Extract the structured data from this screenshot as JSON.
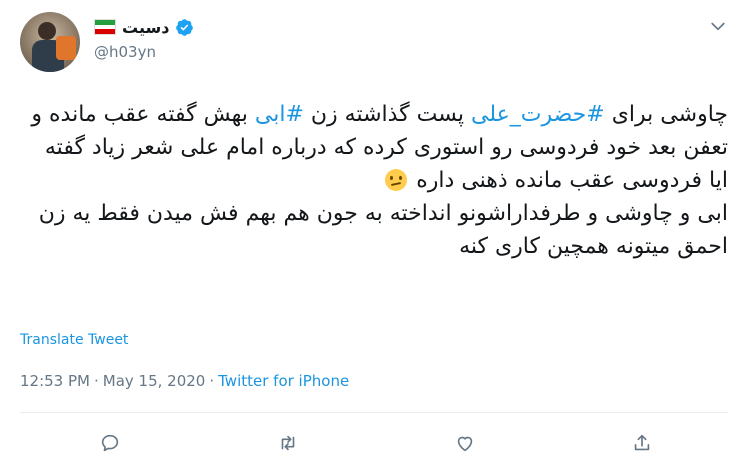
{
  "user": {
    "display_name": "دسیت",
    "handle": "@h03yn",
    "flag_colors": [
      "#239f40",
      "#ffffff",
      "#da0000"
    ],
    "verified_color": "#1da1f2"
  },
  "tweet": {
    "seg1": "چاوشی برای ",
    "hashtag1": "#حضرت_علی",
    "seg2": " پست گذاشته زن ",
    "hashtag2": "#ابی",
    "seg3": " بهش گفته عقب مانده و تعفن بعد خود فردوسی رو استوری کرده که درباره امام علی شعر زیاد گفته ایا فردوسی عقب مانده ذهنی داره",
    "emoji": "confused-face",
    "para2": "ابی و چاوشی و طرفداراشونو انداخته به جون هم بهم فش میدن فقط یه زن احمق میتونه همچین کاری کنه"
  },
  "translate_label": "Translate Tweet",
  "meta": {
    "time": "12:53 PM",
    "sep1": "·",
    "date": "May 15, 2020",
    "sep2": "·",
    "source": "Twitter for iPhone"
  },
  "colors": {
    "link": "#1b95e0",
    "secondary": "#657786",
    "text": "#14171a"
  },
  "actions": [
    "reply-icon",
    "retweet-icon",
    "like-icon",
    "share-icon"
  ]
}
